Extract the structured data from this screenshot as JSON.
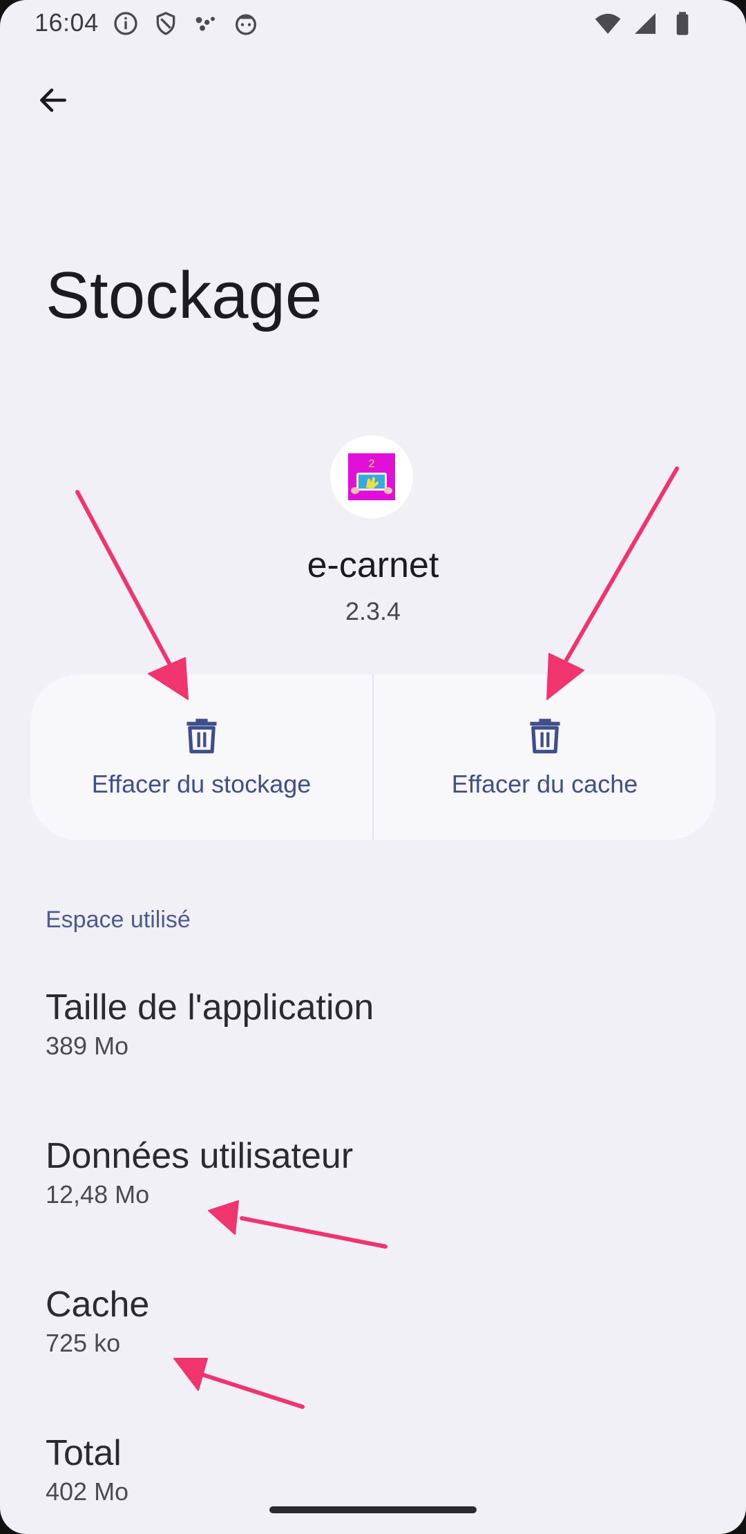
{
  "status_bar": {
    "time": "16:04",
    "left_icons": [
      "info-icon",
      "shield-icon",
      "dots-icon",
      "android-face-icon"
    ],
    "right_icons": [
      "wifi-icon",
      "signal-icon",
      "battery-icon"
    ]
  },
  "header": {
    "back_icon": "arrow-left-icon",
    "title": "Stockage"
  },
  "app": {
    "name": "e-carnet",
    "version": "2.3.4",
    "icon_colors": {
      "background": "#e010d8",
      "screen": "#38a8e0",
      "hand": "#f0e040"
    }
  },
  "actions": {
    "clear_storage_label": "Effacer du stockage",
    "clear_cache_label": "Effacer du cache",
    "icon": "trash-icon"
  },
  "storage": {
    "section_label": "Espace utilisé",
    "rows": [
      {
        "title": "Taille de l'application",
        "value": "389 Mo"
      },
      {
        "title": "Données utilisateur",
        "value": "12,48 Mo"
      },
      {
        "title": "Cache",
        "value": "725 ko"
      },
      {
        "title": "Total",
        "value": "402 Mo"
      }
    ]
  },
  "colors": {
    "background": "#f1f0f6",
    "accent": "#3f4f8c",
    "annotation_arrow": "#f0346e"
  }
}
